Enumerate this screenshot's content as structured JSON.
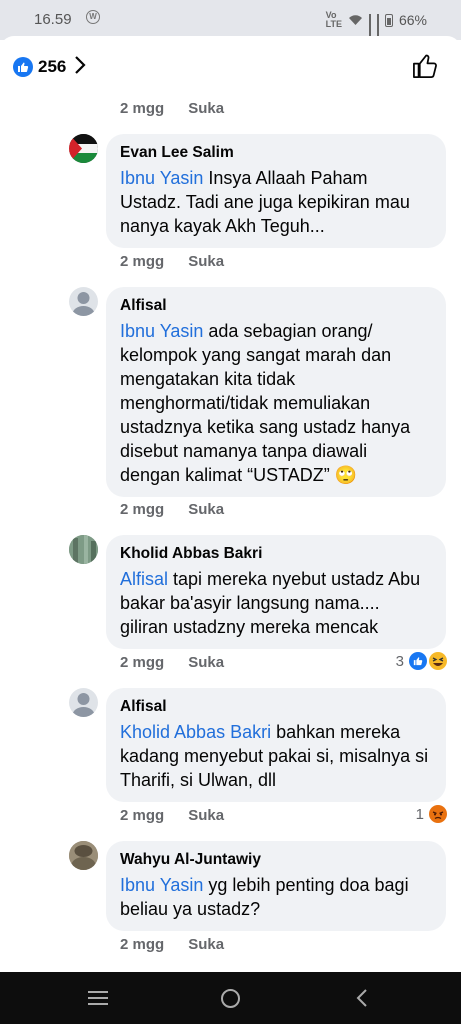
{
  "status": {
    "time": "16.59",
    "battery": "66%"
  },
  "header": {
    "like_count": "256"
  },
  "comments": [
    {
      "meta": {
        "age": "2 mgg",
        "action": "Suka"
      }
    },
    {
      "author": "Evan Lee Salim",
      "mention": "Ibnu Yasin",
      "text": " Insya Allaah Paham Ustadz. Tadi ane juga kepikiran mau nanya kayak Akh Teguh...",
      "meta": {
        "age": "2 mgg",
        "action": "Suka"
      }
    },
    {
      "author": "Alfisal",
      "mention": "Ibnu Yasin",
      "text": " ada sebagian orang/ kelompok yang sangat marah dan mengatakan kita tidak menghormati/tidak memuliakan ustadznya ketika sang ustadz hanya disebut namanya tanpa diawali dengan kalimat “USTADZ” 🙄",
      "meta": {
        "age": "2 mgg",
        "action": "Suka"
      }
    },
    {
      "author": "Kholid Abbas Bakri",
      "mention": "Alfisal",
      "text": " tapi mereka nyebut ustadz Abu bakar ba'asyir langsung nama.... giliran ustadzny mereka mencak",
      "meta": {
        "age": "2 mgg",
        "action": "Suka"
      },
      "reaction_count": "3",
      "reaction_icons": [
        "like-icon",
        "haha-icon"
      ]
    },
    {
      "author": "Alfisal",
      "mention": "Kholid Abbas Bakri",
      "text": " bahkan mereka kadang menyebut pakai si, misalnya si Tharifi, si Ulwan, dll",
      "meta": {
        "age": "2 mgg",
        "action": "Suka"
      },
      "reaction_count": "1",
      "reaction_icons": [
        "angry-icon"
      ]
    },
    {
      "author": "Wahyu Al-Juntawiy",
      "mention": "Ibnu Yasin",
      "text": " yg lebih penting doa bagi beliau ya ustadz?",
      "meta": {
        "age": "2 mgg",
        "action": "Suka"
      }
    }
  ],
  "colors": {
    "mention": "#216fdb",
    "like_blue": "#1877f2",
    "bubble": "#f0f2f5",
    "meta": "#65676b"
  }
}
